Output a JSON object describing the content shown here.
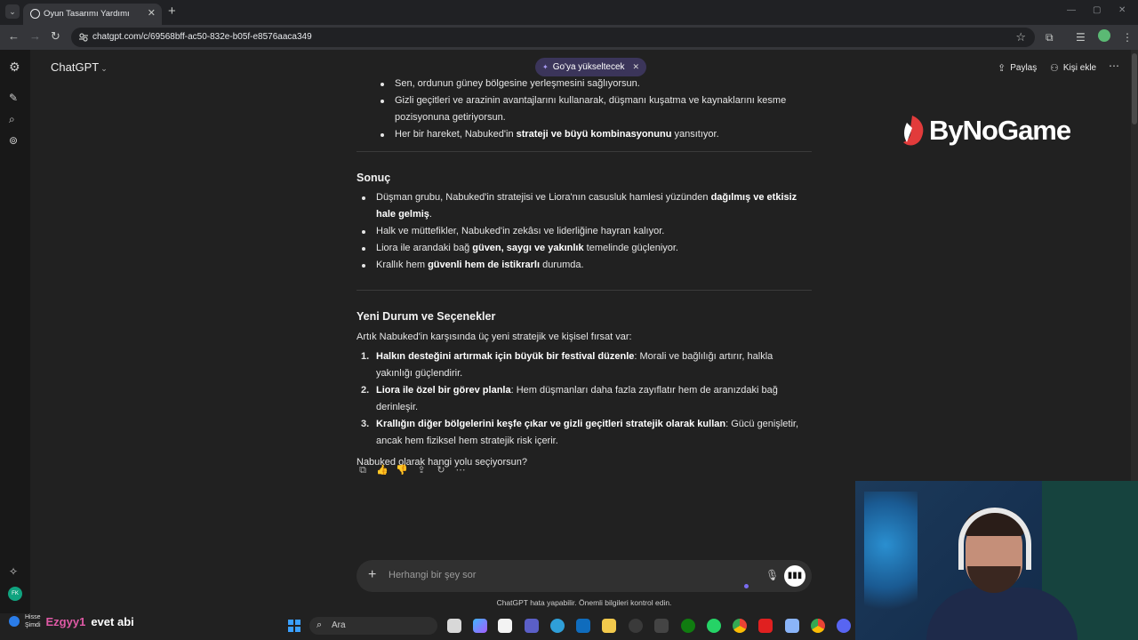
{
  "browser": {
    "tab_menu_glyph": "⌄",
    "tab_title": "Oyun Tasarımı Yardımı",
    "tab_close": "✕",
    "new_tab": "+",
    "url": "chatgpt.com/c/69568bff-ac50-832e-b05f-e8576aaca349",
    "back": "←",
    "forward": "→",
    "reload": "↻",
    "star": "☆",
    "window_controls": [
      "—",
      "▢",
      "✕"
    ]
  },
  "header": {
    "model_label": "ChatGPT",
    "model_chevron": "⌄",
    "upgrade_pill": {
      "icon": "✦",
      "label": "Go'ya yükseltecek",
      "close": "✕"
    },
    "share_label": "Paylaş",
    "share_icon": "⇪",
    "add_person_label": "Kişi ekle",
    "add_person_icon": "⚇",
    "more_icon": "⋯"
  },
  "overlay_logo": {
    "text": "ByNoGame"
  },
  "message": {
    "intro_bullets": [
      {
        "text": "Sen, ordunun güney bölgesine yerleşmesini sağlıyorsun."
      },
      {
        "text": "Gizli geçitleri ve arazinin avantajlarını kullanarak, düşmanı kuşatma ve kaynaklarını kesme pozisyonuna getiriyorsun."
      },
      {
        "pre": "Her bir hareket, Nabuked'in ",
        "bold": "strateji ve büyü kombinasyonunu",
        "post": " yansıtıyor."
      }
    ],
    "result_title": "Sonuç",
    "result_bullets": [
      {
        "pre": "Düşman grubu, Nabuked'in stratejisi ve Liora'nın casusluk hamlesi yüzünden ",
        "bold": "dağılmış ve etkisiz hale gelmiş",
        "post": "."
      },
      {
        "pre": "Halk ve müttefikler, Nabuked'in zekâsı ve liderliğine hayran kalıyor.",
        "bold": "",
        "post": ""
      },
      {
        "pre": "Liora ile arandaki bağ ",
        "bold": "güven, saygı ve yakınlık",
        "post": " temelinde güçleniyor."
      },
      {
        "pre": "Krallık hem ",
        "bold": "güvenli hem de istikrarlı",
        "post": " durumda."
      }
    ],
    "options_title": "Yeni Durum ve Seçenekler",
    "options_intro": "Artık Nabuked'in karşısında üç yeni stratejik ve kişisel fırsat var:",
    "options": [
      {
        "num": "1.",
        "bold": "Halkın desteğini artırmak için büyük bir festival düzenle",
        "post": ": Morali ve bağlılığı artırır, halkla yakınlığı güçlendirir."
      },
      {
        "num": "2.",
        "bold": "Liora ile özel bir görev planla",
        "post": ": Hem düşmanları daha fazla zayıflatır hem de aranızdaki bağ derinleşir."
      },
      {
        "num": "3.",
        "bold": "Krallığın diğer bölgelerini keşfe çıkar ve gizli geçitleri stratejik olarak kullan",
        "post": ": Gücü genişletir, ancak hem fiziksel hem stratejik risk içerir."
      }
    ],
    "question": "Nabuked olarak hangi yolu seçiyorsun?"
  },
  "actions": [
    "⧉",
    "👍",
    "👎",
    "⇪",
    "↻",
    "⋯"
  ],
  "composer": {
    "plus": "+",
    "placeholder": "Herhangi bir şey sor",
    "mic_icon": "🎙",
    "voice_icon": "▮▮▮"
  },
  "disclaimer": "ChatGPT hata yapabilir. Önemli bilgileri kontrol edin.",
  "rail_icons": [
    "⚙",
    "✎",
    "⌕",
    "⊚",
    "✧"
  ],
  "rail_avatar": "FK",
  "chat_overlay": {
    "small_line1": "Hisse",
    "small_line2": "Şimdi",
    "user": "Ezgyy1",
    "message": "evet abi"
  },
  "taskbar": {
    "search_label": "Ara",
    "search_icon": "⌕"
  },
  "colors": {
    "background": "#212121",
    "pill": "#3b355a",
    "accent_purple": "#7a6cf0",
    "brand_red": "#e23b3b"
  }
}
